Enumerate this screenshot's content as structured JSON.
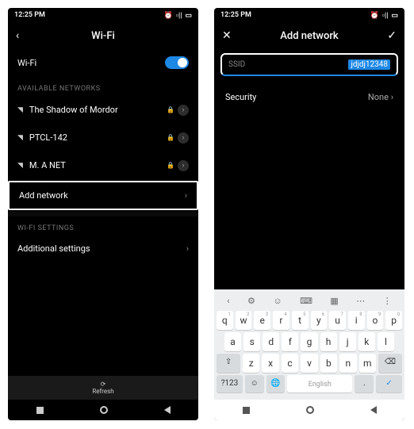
{
  "left": {
    "status": {
      "time": "12:25 PM",
      "alarm": "⏰",
      "signal": "▫︎||",
      "battery": "▭"
    },
    "topbar": {
      "back": "‹",
      "title": "Wi-Fi"
    },
    "wifi_toggle_label": "Wi-Fi",
    "section_available": "AVAILABLE NETWORKS",
    "networks": [
      {
        "name": "The Shadow of Mordor"
      },
      {
        "name": "PTCL-142"
      },
      {
        "name": "M. A NET"
      }
    ],
    "add_network": "Add network",
    "section_settings": "WI-FI SETTINGS",
    "additional": "Additional settings",
    "refresh": "Refresh"
  },
  "right": {
    "status": {
      "time": "12:25 PM",
      "alarm": "⏰",
      "signal": "▫︎||",
      "battery": "▭"
    },
    "topbar": {
      "close": "✕",
      "title": "Add network",
      "confirm": "✓"
    },
    "ssid": {
      "placeholder": "SSID",
      "value": "jdjdj12348"
    },
    "security": {
      "label": "Security",
      "value": "None"
    },
    "keyboard": {
      "toolbar": [
        "‹",
        "⚙",
        "☺",
        "⌨",
        "▦",
        "⋯",
        "⋮"
      ],
      "row1": [
        [
          "q",
          "1"
        ],
        [
          "w",
          "2"
        ],
        [
          "e",
          "3"
        ],
        [
          "r",
          "4"
        ],
        [
          "t",
          "5"
        ],
        [
          "y",
          "6"
        ],
        [
          "u",
          "7"
        ],
        [
          "i",
          "8"
        ],
        [
          "o",
          "9"
        ],
        [
          "p",
          "0"
        ]
      ],
      "row2": [
        "a",
        "s",
        "d",
        "f",
        "g",
        "h",
        "j",
        "k",
        "l"
      ],
      "row3": [
        "⇧",
        "z",
        "x",
        "c",
        "v",
        "b",
        "n",
        "m",
        "⌫"
      ],
      "row4": {
        "sym": "?123",
        "emoji": "☺",
        "globe": "🌐",
        "space": "English",
        "dot": ".",
        "enter": "✓"
      }
    }
  }
}
